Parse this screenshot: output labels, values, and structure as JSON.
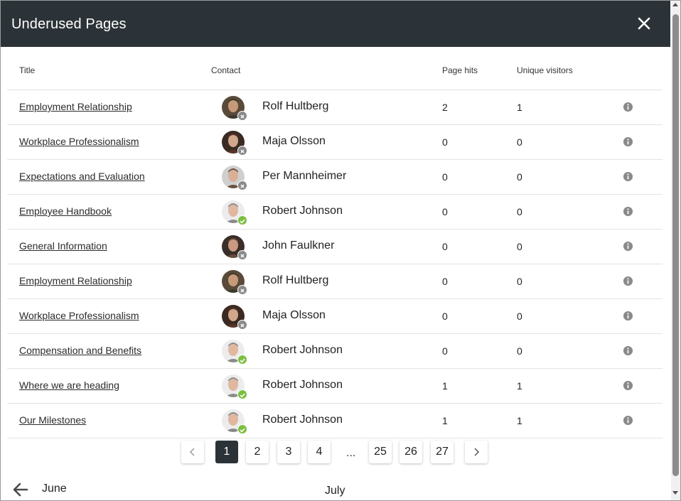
{
  "dialog": {
    "title": "Underused Pages",
    "close_icon": "close-icon"
  },
  "table": {
    "columns": {
      "title": "Title",
      "contact": "Contact",
      "hits": "Page hits",
      "visitors": "Unique visitors"
    },
    "rows": [
      {
        "title": "Employment Relationship",
        "contact": "Rolf Hultberg",
        "status": "offline",
        "hits": "2",
        "visitors": "1"
      },
      {
        "title": "Workplace Professionalism",
        "contact": "Maja Olsson",
        "status": "offline",
        "hits": "0",
        "visitors": "0"
      },
      {
        "title": "Expectations and Evaluation",
        "contact": "Per Mannheimer",
        "status": "offline",
        "hits": "0",
        "visitors": "0"
      },
      {
        "title": "Employee Handbook",
        "contact": "Robert Johnson",
        "status": "online",
        "hits": "0",
        "visitors": "0"
      },
      {
        "title": "General Information",
        "contact": "John Faulkner",
        "status": "offline",
        "hits": "0",
        "visitors": "0"
      },
      {
        "title": "Employment Relationship",
        "contact": "Rolf Hultberg",
        "status": "offline",
        "hits": "0",
        "visitors": "0"
      },
      {
        "title": "Workplace Professionalism",
        "contact": "Maja Olsson",
        "status": "offline",
        "hits": "0",
        "visitors": "0"
      },
      {
        "title": "Compensation and Benefits",
        "contact": "Robert Johnson",
        "status": "online",
        "hits": "0",
        "visitors": "0"
      },
      {
        "title": "Where we are heading",
        "contact": "Robert Johnson",
        "status": "online",
        "hits": "1",
        "visitors": "1"
      },
      {
        "title": "Our Milestones",
        "contact": "Robert Johnson",
        "status": "online",
        "hits": "1",
        "visitors": "1"
      }
    ]
  },
  "pagination": {
    "prev_icon": "chevron-left-icon",
    "next_icon": "chevron-right-icon",
    "pages": [
      "1",
      "2",
      "3",
      "4",
      "25",
      "26",
      "27"
    ],
    "current": "1",
    "ellipsis": "..."
  },
  "footer": {
    "back_icon": "arrow-left-icon",
    "previous_month": "June",
    "current_month": "July"
  },
  "colors": {
    "header_bg": "#2b3338",
    "status_online": "#7bbf3f",
    "status_offline": "#8a8a8a",
    "info_icon": "#8a8a8a"
  }
}
